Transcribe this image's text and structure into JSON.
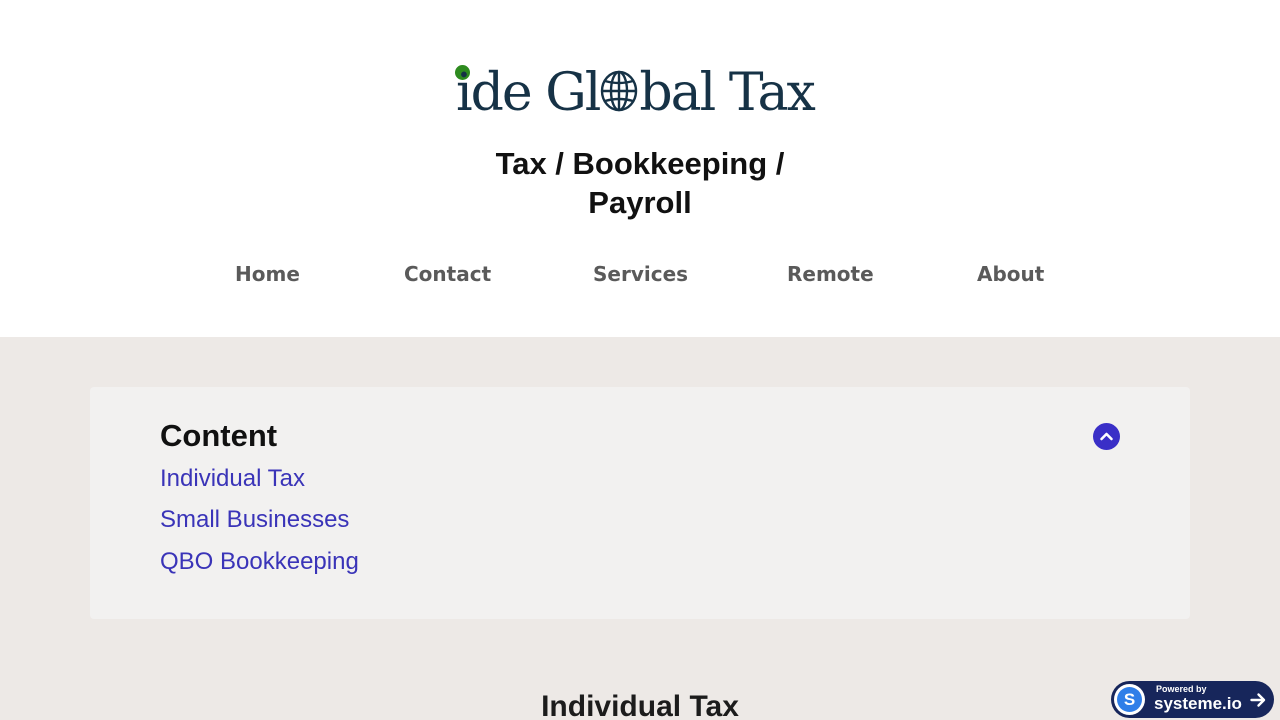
{
  "header": {
    "logo": {
      "text_before": "ide Gl",
      "text_after": "bal Tax",
      "dot_color": "#2e8b1f",
      "text_color": "#163246",
      "globe_icon": "globe-icon"
    },
    "tagline": "Tax / Bookkeeping / Payroll"
  },
  "nav": {
    "items": [
      {
        "label": "Home"
      },
      {
        "label": "Contact"
      },
      {
        "label": "Services"
      },
      {
        "label": "Remote"
      },
      {
        "label": "About"
      }
    ]
  },
  "toc": {
    "title": "Content",
    "toggle_icon": "chevron-up-icon",
    "accent_color": "#3a2fc7",
    "links": [
      {
        "label": "Individual Tax"
      },
      {
        "label": "Small Businesses"
      },
      {
        "label": "QBO Bookkeeping"
      }
    ]
  },
  "main": {
    "section_heading": "Individual Tax"
  },
  "badge": {
    "powered_by": "Powered by",
    "brand": "systeme.io",
    "logo_letter": "S",
    "arrow_icon": "arrow-right-icon"
  }
}
